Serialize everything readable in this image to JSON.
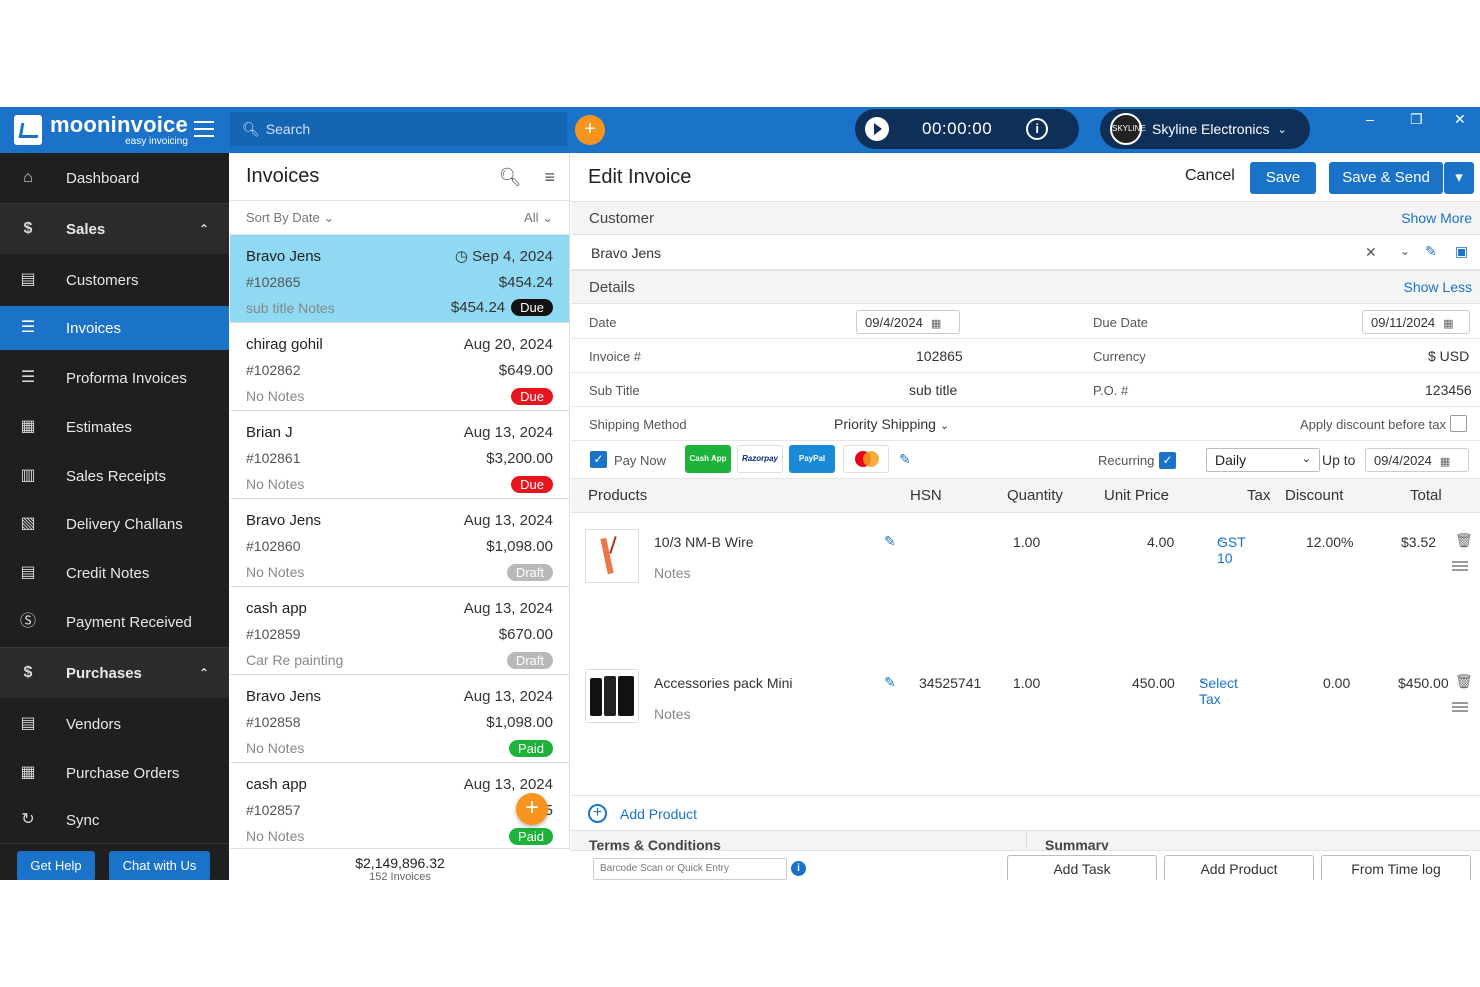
{
  "app": {
    "logo_title": "mooninvoice",
    "logo_sub": "easy invoicing",
    "search_placeholder": "Search",
    "timer": "00:00:00",
    "company": "Skyline Electronics",
    "company_avatar": "SKYLINE"
  },
  "sidebar": {
    "items": [
      {
        "label": "Dashboard",
        "icon": "home-icon"
      },
      {
        "label": "Sales",
        "icon": "sales-icon"
      },
      {
        "label": "Customers",
        "icon": "contacts-icon"
      },
      {
        "label": "Invoices",
        "icon": "document-icon"
      },
      {
        "label": "Proforma Invoices",
        "icon": "document-icon"
      },
      {
        "label": "Estimates",
        "icon": "calculator-icon"
      },
      {
        "label": "Sales Receipts",
        "icon": "receipt-icon"
      },
      {
        "label": "Delivery Challans",
        "icon": "delivery-icon"
      },
      {
        "label": "Credit Notes",
        "icon": "credit-note-icon"
      },
      {
        "label": "Payment Received",
        "icon": "payment-icon"
      },
      {
        "label": "Purchases",
        "icon": "purchases-icon"
      },
      {
        "label": "Vendors",
        "icon": "contacts-icon"
      },
      {
        "label": "Purchase Orders",
        "icon": "cart-icon"
      },
      {
        "label": "Sync",
        "icon": "sync-icon"
      }
    ],
    "get_help": "Get Help",
    "chat": "Chat with Us"
  },
  "list": {
    "title": "Invoices",
    "sort": "Sort By Date",
    "filter": "All",
    "invoices": [
      {
        "name": "Bravo Jens",
        "date": "Sep 4, 2024",
        "number": "#102865",
        "amount": "$454.24",
        "note": "sub title Notes",
        "due": "$454.24",
        "status": "Due"
      },
      {
        "name": "chirag gohil",
        "date": "Aug 20, 2024",
        "number": "#102862",
        "amount": "$649.00",
        "note": "No Notes",
        "due": "",
        "status": "Due"
      },
      {
        "name": "Brian J",
        "date": "Aug 13, 2024",
        "number": "#102861",
        "amount": "$3,200.00",
        "note": "No Notes",
        "due": "",
        "status": "Due"
      },
      {
        "name": "Bravo Jens",
        "date": "Aug 13, 2024",
        "number": "#102860",
        "amount": "$1,098.00",
        "note": "No Notes",
        "due": "",
        "status": "Draft"
      },
      {
        "name": "cash app",
        "date": "Aug 13, 2024",
        "number": "#102859",
        "amount": "$670.00",
        "note": "Car Re painting",
        "due": "",
        "status": "Draft"
      },
      {
        "name": "Bravo Jens",
        "date": "Aug 13, 2024",
        "number": "#102858",
        "amount": "$1,098.00",
        "note": "No Notes",
        "due": "",
        "status": "Paid"
      },
      {
        "name": "cash app",
        "date": "Aug 13, 2024",
        "number": "#102857",
        "amount": "$5",
        "note": "No Notes",
        "due": "",
        "status": "Paid"
      }
    ],
    "total": "$2,149,896.32",
    "count": "152 Invoices",
    "status_colors": {
      "Due": "#e8141e",
      "Draft": "#b8b8b8",
      "Paid": "#1db33a",
      "DueSelected": "#111111"
    }
  },
  "editor": {
    "title": "Edit Invoice",
    "cancel": "Cancel",
    "save": "Save",
    "save_send": "Save & Send",
    "customer_label": "Customer",
    "show_more": "Show More",
    "customer_value": "Bravo Jens",
    "details_label": "Details",
    "show_less": "Show Less",
    "date_label": "Date",
    "date_value": "09/4/2024",
    "due_date_label": "Due Date",
    "due_date_value": "09/11/2024",
    "invoice_label": "Invoice #",
    "invoice_value": "102865",
    "currency_label": "Currency",
    "currency_value": "$ USD",
    "subtitle_label": "Sub Title",
    "subtitle_value": "sub title",
    "po_label": "P.O. #",
    "po_value": "123456",
    "shipping_label": "Shipping Method",
    "shipping_value": "Priority Shipping",
    "apply_discount": "Apply discount before tax",
    "pay_now": "Pay Now",
    "pay_logos": [
      "Cash App",
      "Razorpay",
      "PayPal",
      "Mastercard"
    ],
    "recurring": "Recurring",
    "recurring_freq": "Daily",
    "up_to": "Up to",
    "up_to_value": "09/4/2024",
    "columns": {
      "products": "Products",
      "hsn": "HSN",
      "quantity": "Quantity",
      "unit_price": "Unit Price",
      "tax": "Tax",
      "discount": "Discount",
      "total": "Total"
    },
    "products": [
      {
        "name": "10/3 NM-B Wire",
        "notes": "Notes",
        "hsn": "",
        "quantity": "1.00",
        "unit_price": "4.00",
        "tax": "GST 10",
        "discount": "12.00%",
        "total": "$3.52"
      },
      {
        "name": "Accessories pack Mini",
        "notes": "Notes",
        "hsn": "34525741",
        "quantity": "1.00",
        "unit_price": "450.00",
        "tax": "Select Tax",
        "discount": "0.00",
        "total": "$450.00"
      }
    ],
    "add_product_link": "Add Product",
    "terms": "Terms & Conditions",
    "summary": "Summary",
    "barcode_placeholder": "Barcode Scan or Quick Entry",
    "add_task": "Add Task",
    "add_product_btn": "Add Product",
    "from_time_log": "From Time log"
  },
  "colors": {
    "brand": "#1a73c8",
    "accent": "#f7941d",
    "sidebar": "#1f1f1f",
    "selected_row": "#8fd9f2"
  }
}
